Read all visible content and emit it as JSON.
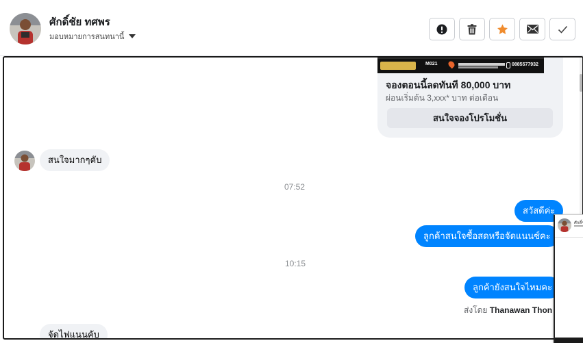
{
  "header": {
    "contact_name": "ศักดิ์ชัย ทศพร",
    "assign_label": "มอบหมายการสนทนานี้",
    "actions": [
      {
        "name": "report",
        "icon": "exclamation-icon"
      },
      {
        "name": "delete",
        "icon": "trash-icon"
      },
      {
        "name": "star",
        "icon": "star-icon"
      },
      {
        "name": "mark-unread",
        "icon": "envelope-icon"
      },
      {
        "name": "done",
        "icon": "check-icon"
      }
    ]
  },
  "promo": {
    "banner_code": "M021",
    "banner_phone": "0885577932",
    "title": "จองตอนนี้ลดทันที 80,000 บาท",
    "subtitle": "ผ่อนเริ่มต้น 3,xxx* บาท ต่อเดือน",
    "button_label": "สนใจจองโปรโมชั่น"
  },
  "messages": [
    {
      "side": "in",
      "text": "สนใจมากๆคับ"
    },
    {
      "time": "07:52"
    },
    {
      "side": "out",
      "text": "สวัสดีค่ะ"
    },
    {
      "side": "out",
      "text": "ลูกค้าสนใจซื้อสดหรือจัดแนนซ์คะ"
    },
    {
      "time": "10:15"
    },
    {
      "side": "out",
      "text": "ลูกค้ายังสนใจไหมคะ"
    },
    {
      "side": "in",
      "text": "จัดไฟแนนคับ"
    }
  ],
  "sent_by": {
    "prefix": "ส่งโดย",
    "name": "Thanawan Thon"
  },
  "floating": {
    "name": "ศักดิ์ชั"
  },
  "colors": {
    "outgoing_bubble": "#0084ff",
    "incoming_bubble": "#f0f2f5",
    "star": "#f08c2e"
  }
}
